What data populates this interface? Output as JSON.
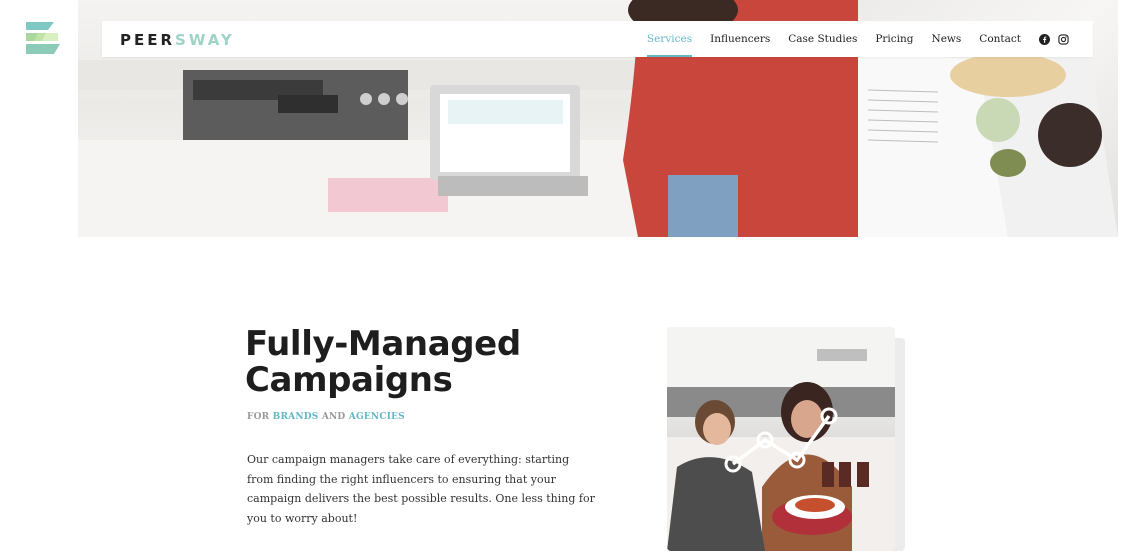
{
  "brand": {
    "part1": "PEER",
    "part2": "SWAY"
  },
  "nav": {
    "items": [
      {
        "label": "Services",
        "active": true
      },
      {
        "label": "Influencers"
      },
      {
        "label": "Case Studies"
      },
      {
        "label": "Pricing"
      },
      {
        "label": "News"
      },
      {
        "label": "Contact"
      }
    ],
    "social": [
      "facebook-icon",
      "instagram-icon"
    ]
  },
  "section": {
    "title_line1": "Fully-Managed",
    "title_line2": "Campaigns",
    "eyebrow_prefix": "FOR",
    "eyebrow_brands": "BRANDS",
    "eyebrow_and": "AND",
    "eyebrow_agencies": "AGENCIES",
    "body": "Our campaign managers take care of everything: starting from finding the right influencers to ensuring that your campaign delivers the best possible results. One less thing for you to worry about!"
  },
  "colors": {
    "accent": "#63b7c6",
    "mint": "#9fd3c8",
    "text": "#1e1e1e"
  }
}
